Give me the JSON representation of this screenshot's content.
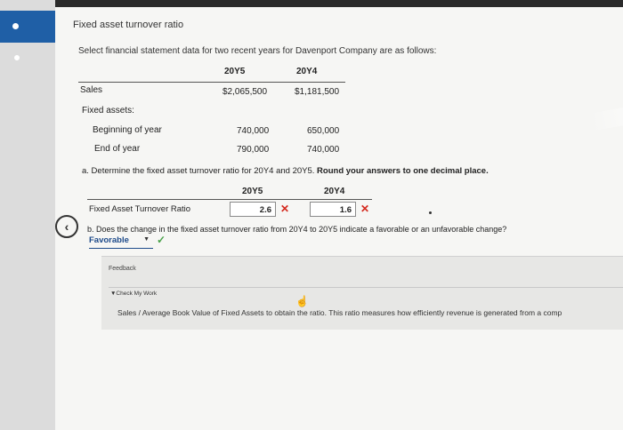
{
  "problem": {
    "title": "Fixed asset turnover ratio",
    "intro": "Select financial statement data for two recent years for Davenport Company are as follows:"
  },
  "data_table": {
    "col_year1": "20Y5",
    "col_year2": "20Y4",
    "sales_label": "Sales",
    "sales_y1": "$2,065,500",
    "sales_y2": "$1,181,500",
    "fixed_assets_label": "Fixed assets:",
    "beginning_label": "Beginning of year",
    "beginning_y1": "740,000",
    "beginning_y2": "650,000",
    "end_label": "End of year",
    "end_y1": "790,000",
    "end_y2": "740,000"
  },
  "part_a": {
    "question_prefix": "a. Determine the fixed asset turnover ratio for 20Y4 and 20Y5.",
    "question_bold": "Round your answers to one decimal place.",
    "col_year1": "20Y5",
    "col_year2": "20Y4",
    "row_label": "Fixed Asset Turnover Ratio",
    "answer_y1": "2.6",
    "answer_y2": "1.6",
    "incorrect_mark": "✕"
  },
  "part_b": {
    "question": "b. Does the change in the fixed asset turnover ratio from 20Y4 to 20Y5 indicate a favorable or an unfavorable change?",
    "selected_value": "Favorable",
    "correct_mark": "✓"
  },
  "feedback": {
    "label": "Feedback",
    "check_my_work": "▼Check My Work",
    "explanation": "Sales / Average Book Value of Fixed Assets to obtain the ratio. This ratio measures how efficiently revenue is generated from a comp"
  },
  "nav": {
    "back_icon": "‹"
  },
  "colors": {
    "accent": "#1f5fa6",
    "error": "#d4281d",
    "success": "#4aa24a"
  }
}
